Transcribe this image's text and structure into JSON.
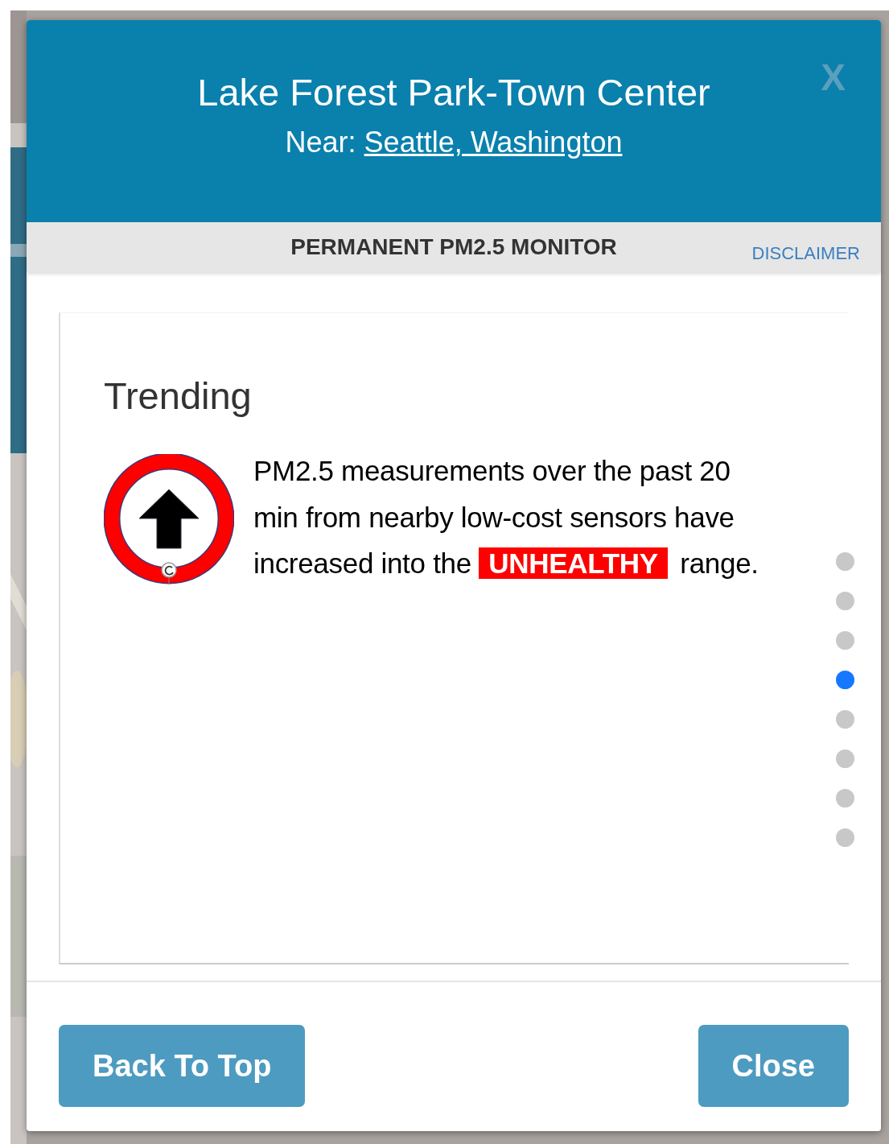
{
  "dialog": {
    "title": "Lake Forest Park-Town Center",
    "near_label": "Near:",
    "near_link": "Seattle, Washington",
    "close_text": "X"
  },
  "subheader": {
    "title": "PERMANENT PM2.5 MONITOR",
    "link": "DISCLAIMER"
  },
  "panel": {
    "heading": "Trending",
    "message": "PM2.5 measurements over the past 20 min from nearby low-cost sensors have increased into the",
    "highlight": "UNHEALTHY",
    "message_end": "range."
  },
  "pager": [
    {
      "selected": false
    },
    {
      "selected": false
    },
    {
      "selected": false
    },
    {
      "selected": true
    },
    {
      "selected": false
    },
    {
      "selected": false
    },
    {
      "selected": false
    },
    {
      "selected": false
    }
  ],
  "buttons": [
    {
      "label": "Back To Top"
    },
    {
      "label": "Close"
    }
  ]
}
